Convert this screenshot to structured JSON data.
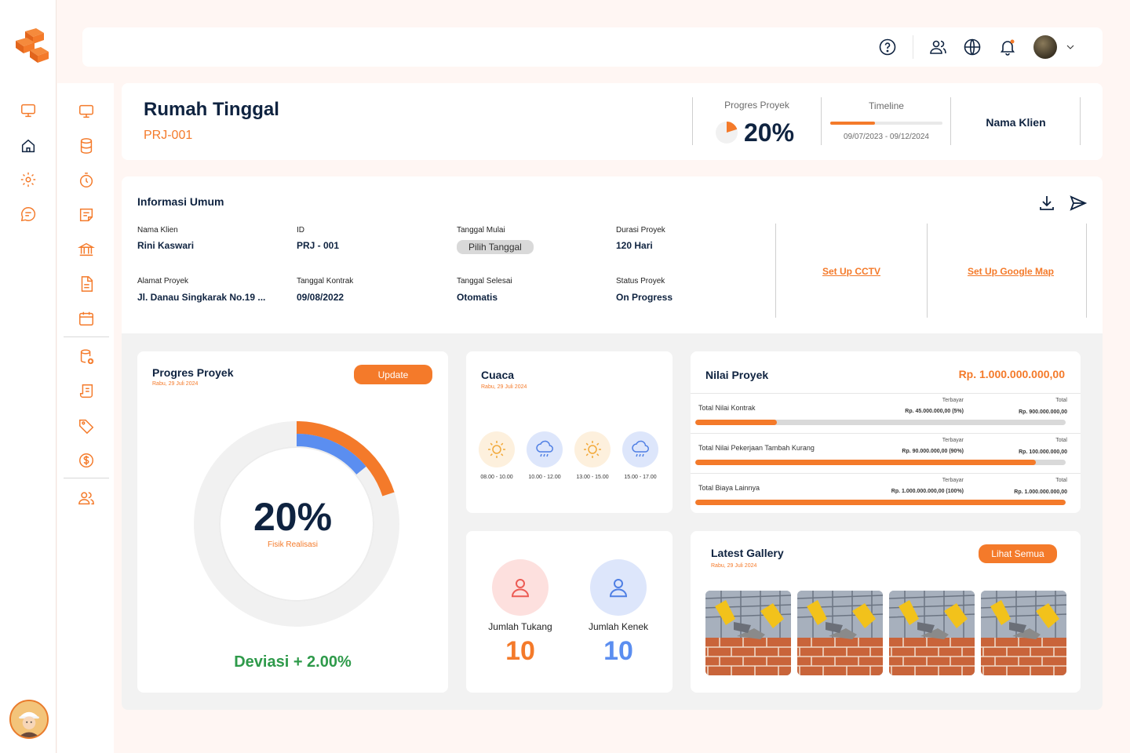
{
  "brand": {
    "accent": "#f47a2a",
    "navy": "#0f2340",
    "logo": "orange-bricks-logo"
  },
  "rail": {
    "icons": [
      "monitor-icon",
      "home-icon",
      "settings-icon",
      "chat-icon"
    ]
  },
  "sidebar": {
    "group1": [
      "monitor-icon",
      "database-icon",
      "stopwatch-icon",
      "note-icon",
      "bank-icon",
      "document-icon",
      "calendar-icon"
    ],
    "group2": [
      "database-add-icon",
      "receipt-icon",
      "tag-icon",
      "dollar-icon"
    ],
    "group3": [
      "users-icon"
    ]
  },
  "topbar": {
    "icons": [
      "help-icon",
      "users-icon",
      "globe-icon",
      "bell-icon"
    ],
    "avatar": "user-avatar"
  },
  "header": {
    "title": "Rumah Tinggal",
    "code": "PRJ-001",
    "progress_label": "Progres Proyek",
    "progress_value": "20%",
    "timeline_label": "Timeline",
    "timeline_dates": "09/07/2023 - 09/12/2024",
    "timeline_fraction": 0.4,
    "client_label": "Nama Klien"
  },
  "info": {
    "title": "Informasi Umum",
    "fields": [
      {
        "label": "Nama Klien",
        "value": "Rini Kaswari"
      },
      {
        "label": "ID",
        "value": "PRJ - 001"
      },
      {
        "label": "Tanggal Mulai",
        "value": "Pilih Tanggal"
      },
      {
        "label": "Durasi Proyek",
        "value": "120 Hari"
      },
      {
        "label": "Alamat Proyek",
        "value": "Jl. Danau Singkarak No.19 ..."
      },
      {
        "label": "Tanggal Kontrak",
        "value": "09/08/2022"
      },
      {
        "label": "Tanggal Selesai",
        "value": "Otomatis"
      },
      {
        "label": "Status Proyek",
        "value": "On Progress"
      }
    ],
    "cctv_link": "Set Up CCTV",
    "map_link": "Set Up Google Map"
  },
  "progress_card": {
    "title": "Progres Proyek",
    "date": "Rabu, 29 Juli 2024",
    "update_button": "Update",
    "percent": "20%",
    "caption": "Fisik Realisasi",
    "deviation": "Deviasi + 2.00%",
    "actual_fraction": 0.2,
    "plan_fraction": 0.14
  },
  "weather_card": {
    "title": "Cuaca",
    "date": "Rabu, 29 Juli 2024",
    "slots": [
      {
        "time": "08.00 - 10.00",
        "icon": "sun-icon"
      },
      {
        "time": "10.00 - 12.00",
        "icon": "rain-cloud-icon"
      },
      {
        "time": "13.00 - 15.00",
        "icon": "sun-icon"
      },
      {
        "time": "15.00 - 17.00",
        "icon": "rain-cloud-icon"
      }
    ]
  },
  "workers_card": {
    "tukang_label": "Jumlah Tukang",
    "tukang_value": "10",
    "kenek_label": "Jumlah Kenek",
    "kenek_value": "10"
  },
  "value_card": {
    "title": "Nilai Proyek",
    "total": "Rp. 1.000.000.000,00",
    "rows": [
      {
        "label": "Total Nilai Kontrak",
        "paid_label": "Terbayar",
        "paid": "Rp. 45.000.000,00 (5%)",
        "total_label": "Total",
        "total": "Rp. 900.000.000,00",
        "fraction": 0.22
      },
      {
        "label": "Total Nilai Pekerjaan Tambah Kurang",
        "paid_label": "Terbayar",
        "paid": "Rp. 90.000.000,00 (90%)",
        "total_label": "Total",
        "total": "Rp. 100.000.000,00",
        "fraction": 0.92
      },
      {
        "label": "Total Biaya Lainnya",
        "paid_label": "Terbayar",
        "paid": "Rp. 1.000.000.000,00 (100%)",
        "total_label": "Total",
        "total": "Rp. 1.000.000.000,00",
        "fraction": 1.0
      }
    ]
  },
  "gallery_card": {
    "title": "Latest Gallery",
    "date": "Rabu, 29 Juli 2024",
    "button": "Lihat Semua",
    "images": [
      "bricklaying-photo",
      "bricklaying-photo",
      "bricklaying-photo",
      "bricklaying-photo"
    ]
  }
}
